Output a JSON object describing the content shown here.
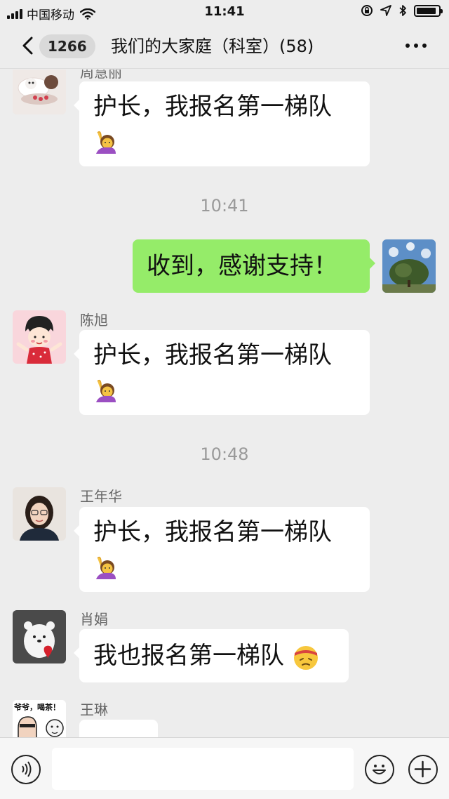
{
  "status_bar": {
    "carrier": "中国移动",
    "time": "11:41",
    "battery_level": 0.9
  },
  "nav": {
    "unread_count": "1266",
    "title": "我们的大家庭（科室）(58)"
  },
  "messages": [
    {
      "sender": "周慧丽",
      "text": "护长，我报名第一梯队",
      "emoji": "raising-hand-woman"
    },
    {
      "timestamp": "10:41"
    },
    {
      "sender": "me",
      "text": "收到，感谢支持！"
    },
    {
      "sender": "陈旭",
      "text": "护长，我报名第一梯队",
      "emoji": "raising-hand-woman"
    },
    {
      "timestamp": "10:48"
    },
    {
      "sender": "王年华",
      "text": "护长，我报名第一梯队",
      "emoji": "raising-hand-woman"
    },
    {
      "sender": "肖娟",
      "text": "我也报名第一梯队",
      "emoji": "headband-face"
    },
    {
      "sender": "王琳",
      "avatar_caption": "爷爷，喝茶！"
    }
  ],
  "colors": {
    "background": "#ededed",
    "bubble_self": "#95ec69",
    "bubble_other": "#ffffff",
    "timestamp": "#9a9a9a"
  }
}
